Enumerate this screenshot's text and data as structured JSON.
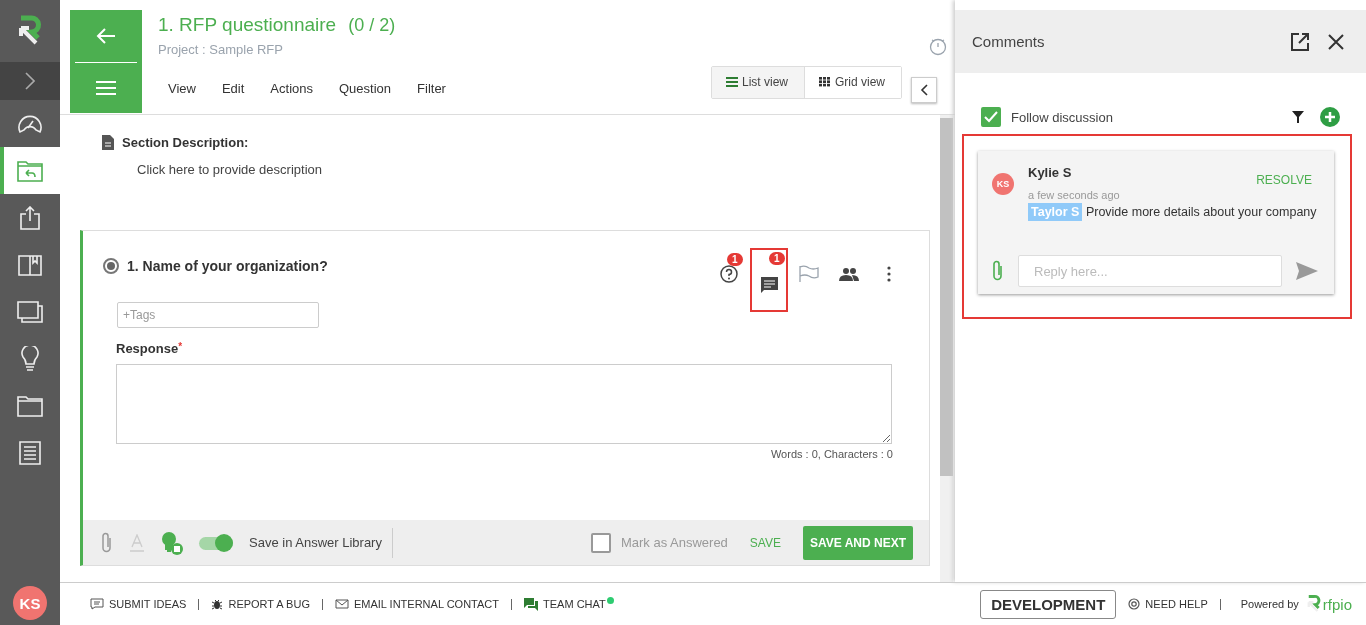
{
  "sidebar": {
    "items": [
      {
        "kind": "dashboard",
        "selected": false
      },
      {
        "kind": "responses",
        "selected": true
      },
      {
        "kind": "upload",
        "selected": false
      },
      {
        "kind": "book",
        "selected": false
      },
      {
        "kind": "windows",
        "selected": false
      },
      {
        "kind": "bulb",
        "selected": false
      },
      {
        "kind": "folder",
        "selected": false
      },
      {
        "kind": "list",
        "selected": false
      }
    ],
    "avatar": "KS"
  },
  "header": {
    "title": "1. RFP questionnaire",
    "count": "(0 / 2)",
    "project": "Project : Sample RFP",
    "menu": [
      "View",
      "Edit",
      "Actions",
      "Question",
      "Filter"
    ],
    "views": [
      {
        "kind": "list",
        "label": "List view",
        "selected": true
      },
      {
        "kind": "grid",
        "label": "Grid view",
        "selected": false
      }
    ]
  },
  "section": {
    "heading": "Section Description:",
    "prompt": "Click here to provide description"
  },
  "question": {
    "title": "1. Name of your organization?",
    "selected": true,
    "help_badge": "1",
    "comment_badge": "1",
    "tags_placeholder": "+Tags",
    "response_label": "Response",
    "required_mark": "*",
    "counts": "Words : 0, Characters : 0",
    "save_in_library": {
      "label": "Save in Answer Library",
      "on": true
    },
    "mark_answered": {
      "label": "Mark as Answered",
      "checked": false
    },
    "save": "SAVE",
    "save_next": "SAVE AND NEXT"
  },
  "comments": {
    "title": "Comments",
    "follow": {
      "label": "Follow discussion",
      "checked": true
    },
    "items": [
      {
        "initials": "KS",
        "author": "Kylie S",
        "time": "a few seconds ago",
        "mention": "Taylor S",
        "text": "Provide more details about your company",
        "action": "RESOLVE",
        "reply_placeholder": "Reply here..."
      }
    ]
  },
  "footer": {
    "links": [
      {
        "kind": "ideas",
        "label": "SUBMIT IDEAS",
        "online": false
      },
      {
        "kind": "bug",
        "label": "REPORT A BUG",
        "online": false
      },
      {
        "kind": "mail",
        "label": "EMAIL INTERNAL CONTACT",
        "online": false
      },
      {
        "kind": "chat",
        "label": "TEAM CHAT",
        "online": true
      }
    ],
    "environment": "DEVELOPMENT",
    "help": "NEED HELP",
    "powered_by": "Powered by",
    "brand": "rfpio"
  }
}
